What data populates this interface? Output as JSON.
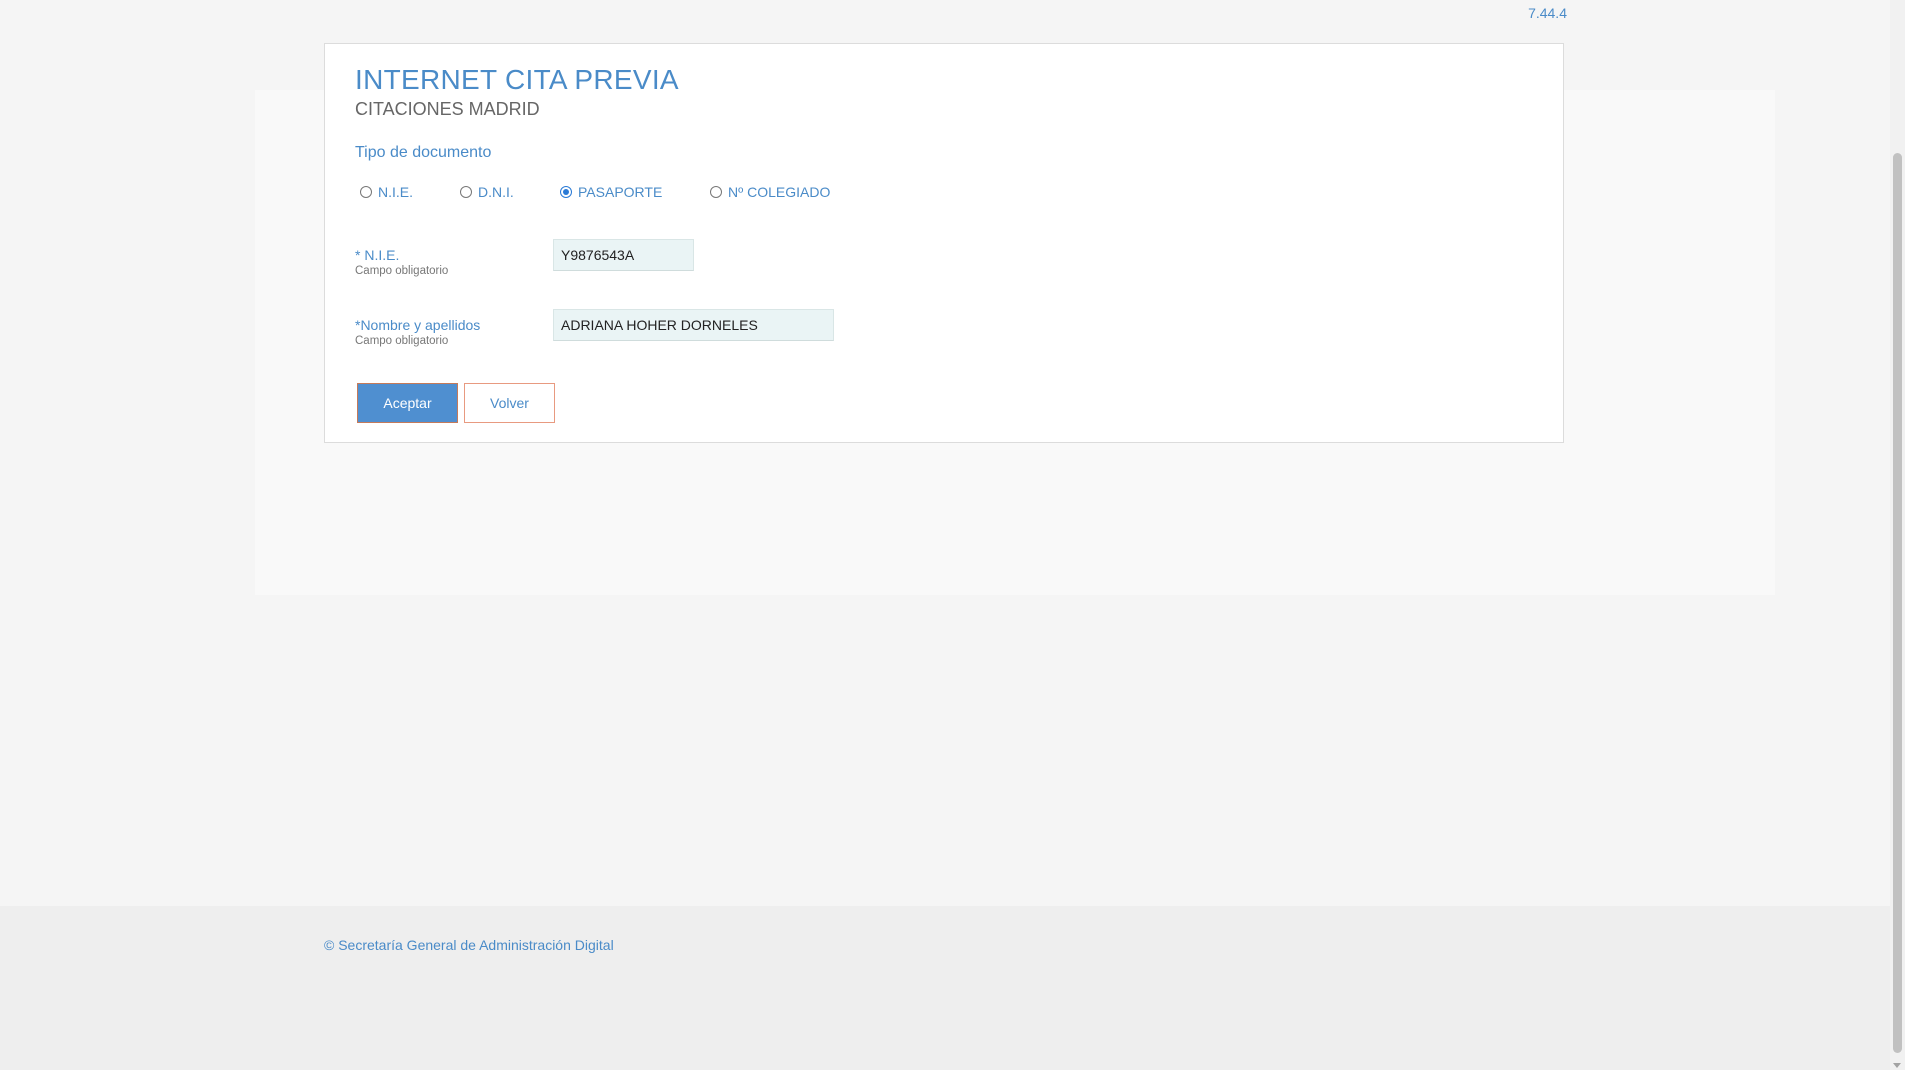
{
  "version": "7.44.4",
  "header": {
    "title": "INTERNET CITA PREVIA",
    "subtitle": "CITACIONES MADRID"
  },
  "document_type": {
    "label": "Tipo de documento",
    "options": [
      {
        "label": "N.I.E.",
        "checked": false
      },
      {
        "label": "D.N.I.",
        "checked": false
      },
      {
        "label": "PASAPORTE",
        "checked": true
      },
      {
        "label": "Nº COLEGIADO",
        "checked": false
      }
    ]
  },
  "fields": {
    "document_number": {
      "label": "* N.I.E.",
      "hint": "Campo obligatorio",
      "value": "Y9876543A"
    },
    "full_name": {
      "label": "*Nombre y apellidos",
      "hint": "Campo obligatorio",
      "value": "ADRIANA HOHER DORNELES"
    }
  },
  "buttons": {
    "accept": "Aceptar",
    "back": "Volver"
  },
  "footer": {
    "text": "© Secretaría General de Administración Digital"
  },
  "colors": {
    "accent": "#4a8bc8",
    "primary_button": "#4f8fd0",
    "input_background": "#eaf4f5",
    "footer_background": "#eeeeee"
  }
}
